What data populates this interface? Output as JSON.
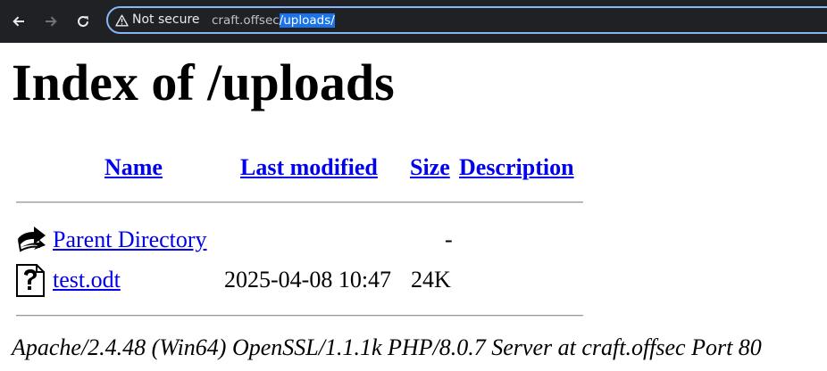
{
  "browser": {
    "security_label": "Not secure",
    "url_host": "craft.offsec",
    "url_path": "/uploads/",
    "accent_color": "#8ab4f8",
    "icons": [
      "back-arrow-icon",
      "forward-arrow-icon",
      "reload-icon",
      "warning-triangle-icon"
    ]
  },
  "page": {
    "title": "Index of /uploads",
    "columns": {
      "name": "Name",
      "last_modified": "Last modified",
      "size": "Size",
      "description": "Description"
    },
    "rows": [
      {
        "icon": "parent-directory-icon",
        "name": "Parent Directory",
        "modified": "",
        "size": "-",
        "description": ""
      },
      {
        "icon": "unknown-file-icon",
        "name": "test.odt",
        "modified": "2025-04-08 10:47",
        "size": "24K",
        "description": ""
      }
    ],
    "footer": "Apache/2.4.48 (Win64) OpenSSL/1.1.1k PHP/8.0.7 Server at craft.offsec Port 80",
    "link_color": "#0000ee"
  }
}
